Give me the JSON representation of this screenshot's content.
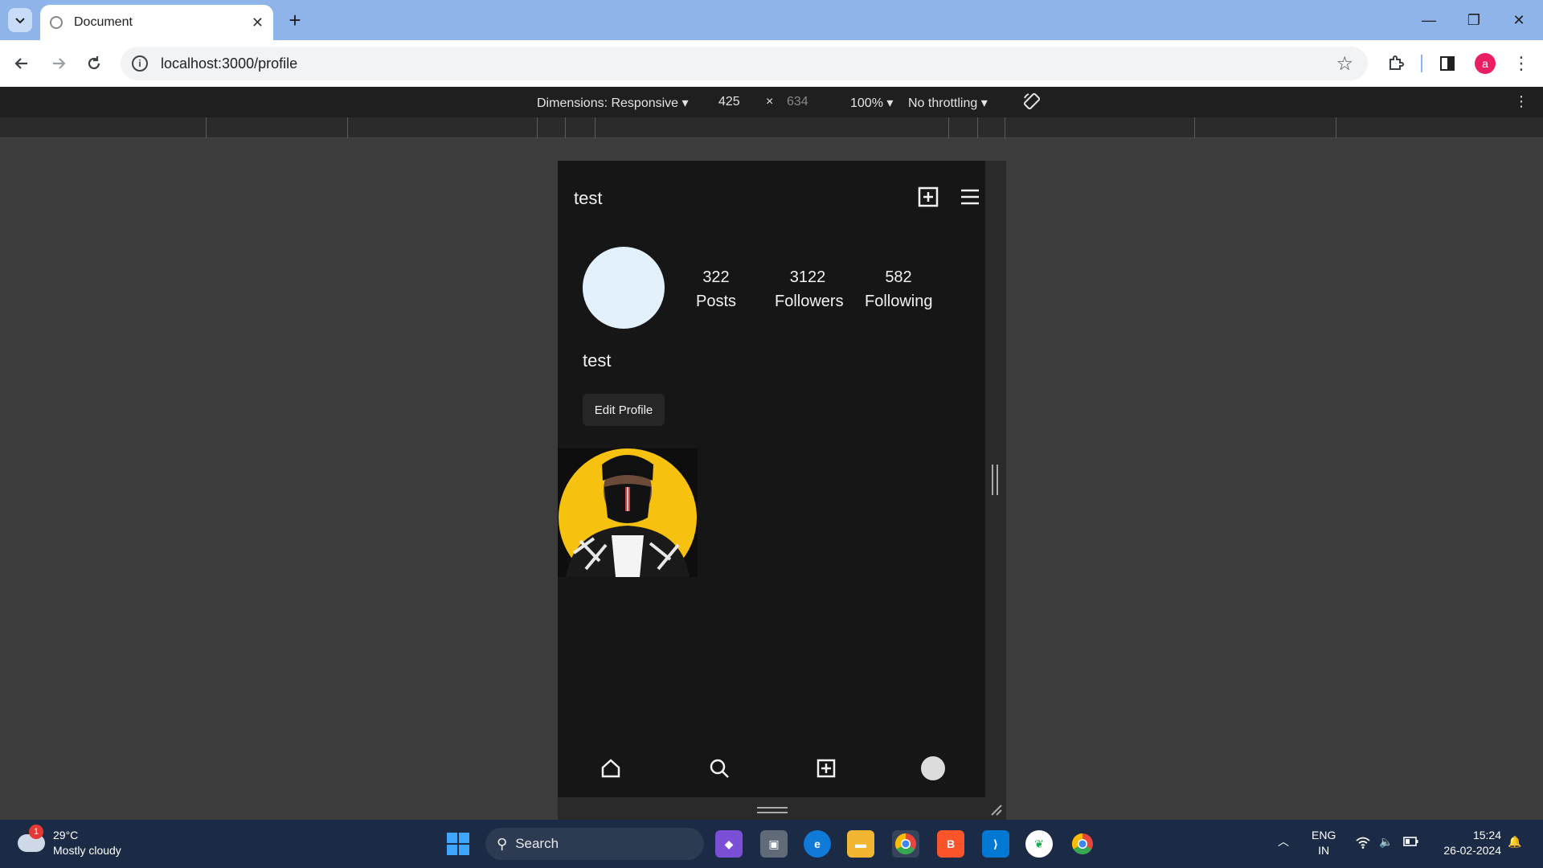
{
  "browser": {
    "tab_title": "Document",
    "url": "localhost:3000/profile",
    "profile_initial": "a"
  },
  "devtools": {
    "dimensions_label": "Dimensions: Responsive",
    "width": "425",
    "times": "×",
    "height": "634",
    "zoom": "100%",
    "throttling": "No throttling"
  },
  "app": {
    "header_username": "test",
    "stats": [
      {
        "value": "322",
        "label": "Posts"
      },
      {
        "value": "3122",
        "label": "Followers"
      },
      {
        "value": "582",
        "label": "Following"
      }
    ],
    "display_name": "test",
    "edit_button": "Edit Profile"
  },
  "taskbar": {
    "weather_temp": "29°C",
    "weather_desc": "Mostly cloudy",
    "weather_badge": "1",
    "search_label": "Search",
    "lang": "ENG",
    "region": "IN",
    "time": "15:24",
    "date": "26-02-2024"
  }
}
